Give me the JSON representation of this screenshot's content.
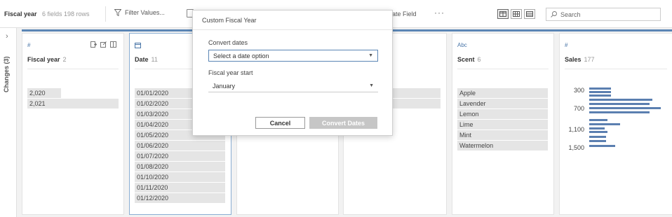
{
  "toolbar": {
    "title": "Fiscal year",
    "meta": "6 fields 198 rows",
    "filter_label": "Filter Values...",
    "create_field_label": "ate Field",
    "more_label": "···",
    "search_placeholder": "Search"
  },
  "left_panel": {
    "changes_label": "Changes (3)"
  },
  "cards": {
    "fiscal_year": {
      "type": "#",
      "name": "Fiscal year",
      "count": "2",
      "values": [
        "2,020",
        "2,021"
      ]
    },
    "date": {
      "type": "date",
      "name": "Date",
      "count": "11",
      "values": [
        "01/01/2020",
        "01/02/2020",
        "01/03/2020",
        "01/04/2020",
        "01/05/2020",
        "01/06/2020",
        "01/07/2020",
        "01/08/2020",
        "01/10/2020",
        "01/11/2020",
        "01/12/2020"
      ]
    },
    "scent": {
      "type": "Abc",
      "name": "Scent",
      "count": "6",
      "values": [
        "Apple",
        "Lavender",
        "Lemon",
        "Lime",
        "Mint",
        "Watermelon"
      ]
    },
    "sales": {
      "type": "#",
      "name": "Sales",
      "count": "177",
      "labels": [
        "300",
        "700",
        "1,100",
        "1,500"
      ]
    }
  },
  "dialog": {
    "title": "Custom Fiscal Year",
    "convert_label": "Convert dates",
    "convert_value": "Select a date option",
    "start_label": "Fiscal year start",
    "start_value": "January",
    "cancel_label": "Cancel",
    "convert_button_label": "Convert Dates"
  },
  "colors": {
    "accent": "#5b86b5",
    "bar": "#5b7fb0"
  }
}
